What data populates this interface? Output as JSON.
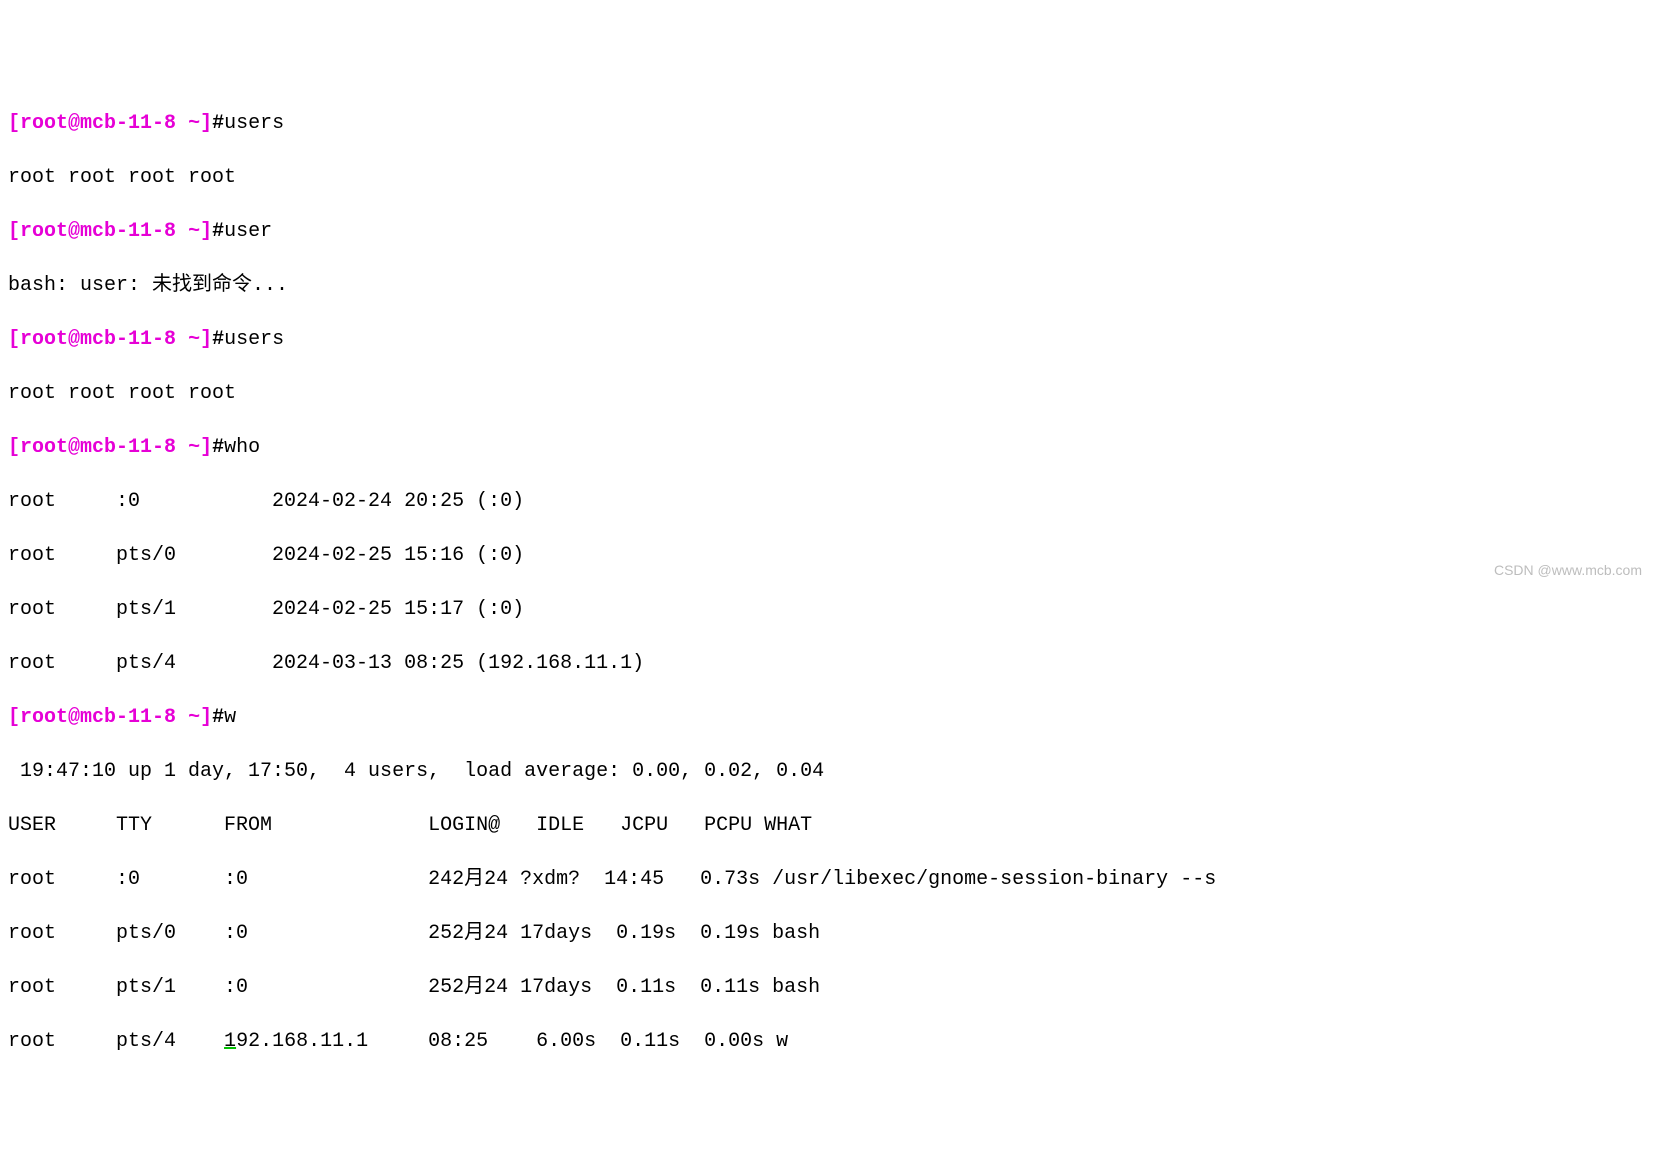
{
  "prompt": {
    "open_bracket": "[",
    "user": "root",
    "at": "@",
    "host": "mcb-11-8",
    "space": " ",
    "tilde": "~",
    "close_bracket": "]",
    "hash": "#"
  },
  "lines": {
    "l1_cmd": "users",
    "l2_out": "root root root root",
    "l3_cmd": "user",
    "l4_out": "bash: user: 未找到命令...",
    "l5_cmd": "users",
    "l6_out": "root root root root",
    "l7_cmd": "who",
    "l8_out": "root     :0           2024-02-24 20:25 (:0)",
    "l9_out": "root     pts/0        2024-02-25 15:16 (:0)",
    "l10_out": "root     pts/1        2024-02-25 15:17 (:0)",
    "l11_out": "root     pts/4        2024-03-13 08:25 (192.168.11.1)",
    "l12_cmd": "w",
    "l13_out": " 19:47:10 up 1 day, 17:50,  4 users,  load average: 0.00, 0.02, 0.04",
    "l14_out": "USER     TTY      FROM             LOGIN@   IDLE   JCPU   PCPU WHAT",
    "l15_out": "root     :0       :0               242月24 ?xdm?  14:45   0.73s /usr/libexec/gnome-session-binary --s",
    "l16_out": "root     pts/0    :0               252月24 17days  0.19s  0.19s bash",
    "l17_out": "root     pts/1    :0               252月24 17days  0.11s  0.11s bash",
    "l18_user": "root     pts/4    ",
    "l18_ip_first": "1",
    "l18_ip_rest": "92.168.11.1     08:25    6.00s  0.11s  0.00s w"
  },
  "watermark": "CSDN @www.mcb.com"
}
